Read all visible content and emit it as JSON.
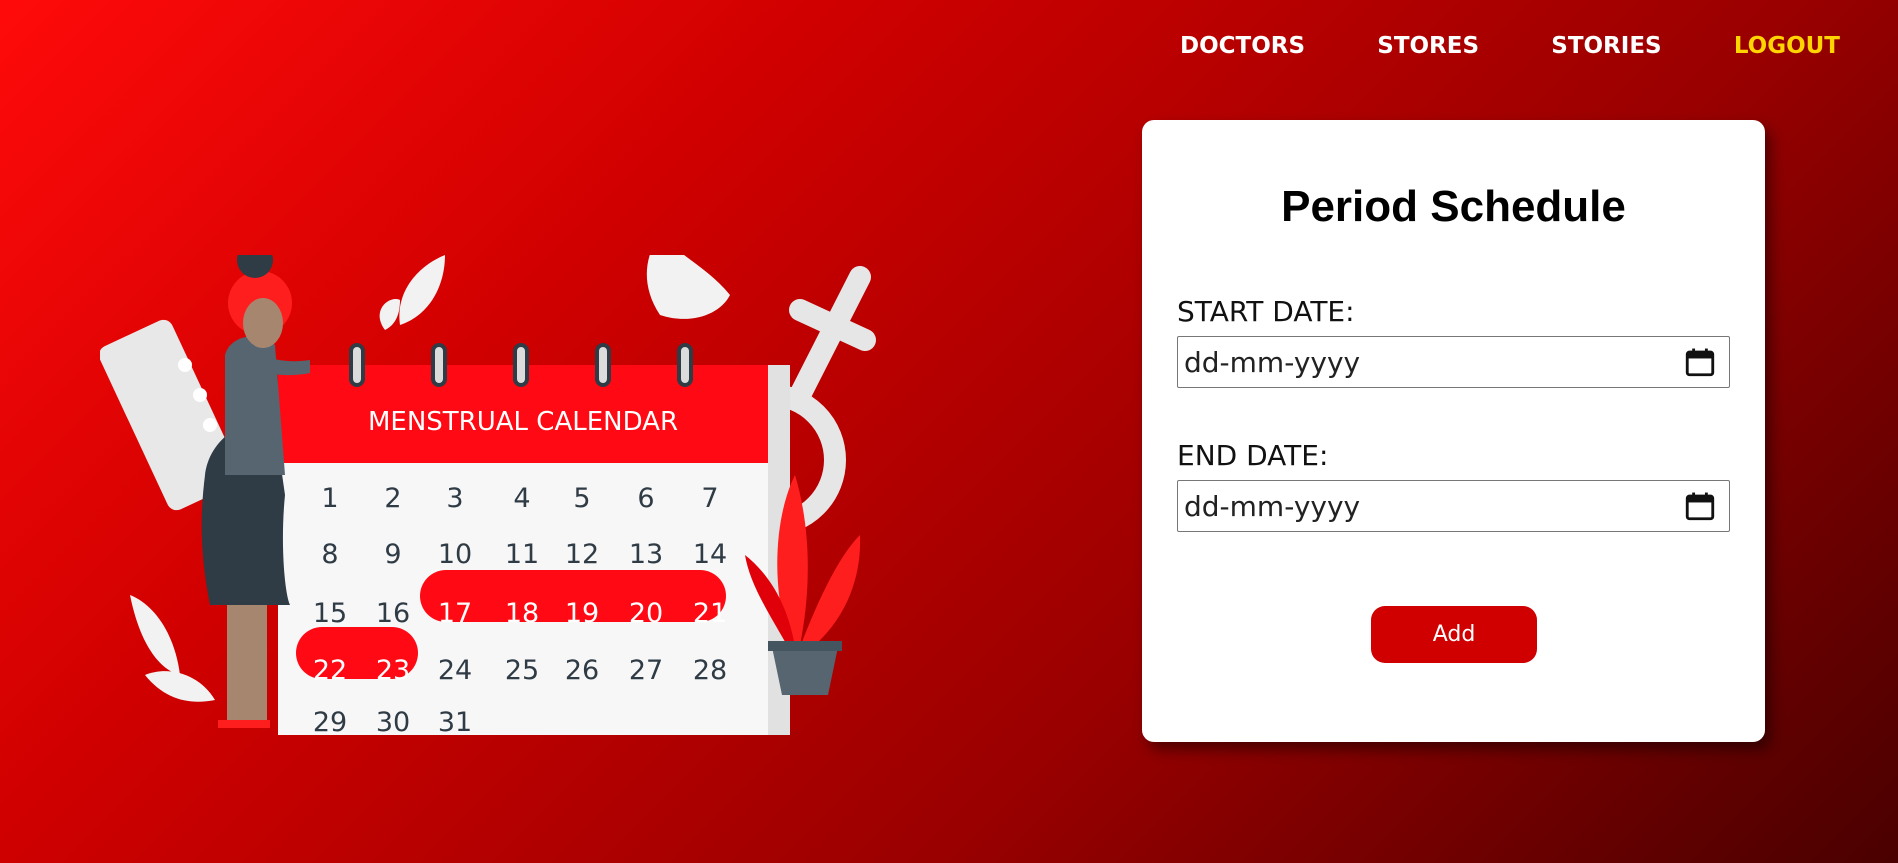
{
  "nav": {
    "items": [
      {
        "label": "DOCTORS"
      },
      {
        "label": "STORES"
      },
      {
        "label": "STORIES"
      },
      {
        "label": "LOGOUT"
      }
    ]
  },
  "illustration": {
    "calendar_title": "MENSTRUAL CALENDAR",
    "days": [
      "1",
      "2",
      "3",
      "4",
      "5",
      "6",
      "7",
      "8",
      "9",
      "10",
      "11",
      "12",
      "13",
      "14",
      "15",
      "16",
      "17",
      "18",
      "19",
      "20",
      "21",
      "22",
      "23",
      "24",
      "25",
      "26",
      "27",
      "28",
      "29",
      "30",
      "31"
    ],
    "highlighted_days": [
      "17",
      "18",
      "19",
      "20",
      "21",
      "22",
      "23"
    ]
  },
  "form": {
    "title": "Period Schedule",
    "start_label": "START DATE:",
    "start_placeholder": "dd-mm-yyyy",
    "end_label": "END DATE:",
    "end_placeholder": "dd-mm-yyyy",
    "add_label": "Add"
  },
  "colors": {
    "accent": "#d00000",
    "logout": "#ffd400"
  }
}
